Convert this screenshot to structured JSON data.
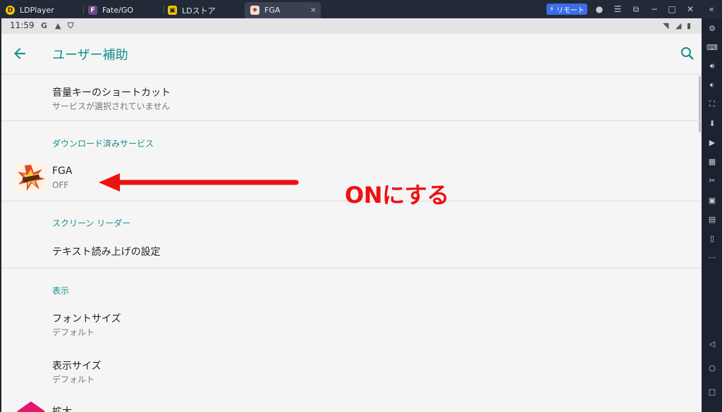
{
  "titlebar": {
    "tabs": [
      {
        "label": "LDPlayer",
        "icon": "ldplayer-logo-icon"
      },
      {
        "label": "Fate/GO",
        "icon": "fate-go-app-icon"
      },
      {
        "label": "LDストア",
        "icon": "ld-store-icon"
      },
      {
        "label": "FGA",
        "icon": "fga-app-icon",
        "active": true
      }
    ],
    "remote_label": "リモート",
    "controls": [
      "account-icon",
      "menu-icon",
      "screen-icon",
      "minimize-icon",
      "maximize-icon",
      "close-icon",
      "collapse-sidebar-icon"
    ]
  },
  "statusbar": {
    "time": "11:59",
    "icons": [
      "google-icon",
      "notification-icon",
      "shield-icon",
      "wifi-icon",
      "signal-icon",
      "battery-icon"
    ]
  },
  "appbar": {
    "title": "ユーザー補助",
    "back_icon": "back-arrow-icon",
    "search_icon": "search-icon"
  },
  "list": {
    "volume_shortcut": {
      "title": "音量キーのショートカット",
      "subtitle": "サービスが選択されていません"
    },
    "downloaded_section": "ダウンロード済みサービス",
    "fga": {
      "title": "FGA",
      "subtitle": "OFF"
    },
    "screen_reader_section": "スクリーン リーダー",
    "tts": {
      "title": "テキスト読み上げの設定"
    },
    "display_section": "表示",
    "font_size": {
      "title": "フォントサイズ",
      "subtitle": "デフォルト"
    },
    "display_size": {
      "title": "表示サイズ",
      "subtitle": "デフォルト"
    },
    "magnify": {
      "title": "拡大"
    }
  },
  "annotation": {
    "text": "ONにする",
    "color": "#ee1111"
  },
  "colors": {
    "accent": "#138e8a",
    "titlebar_bg": "#222a38",
    "remote_btn": "#3b6ee6"
  }
}
